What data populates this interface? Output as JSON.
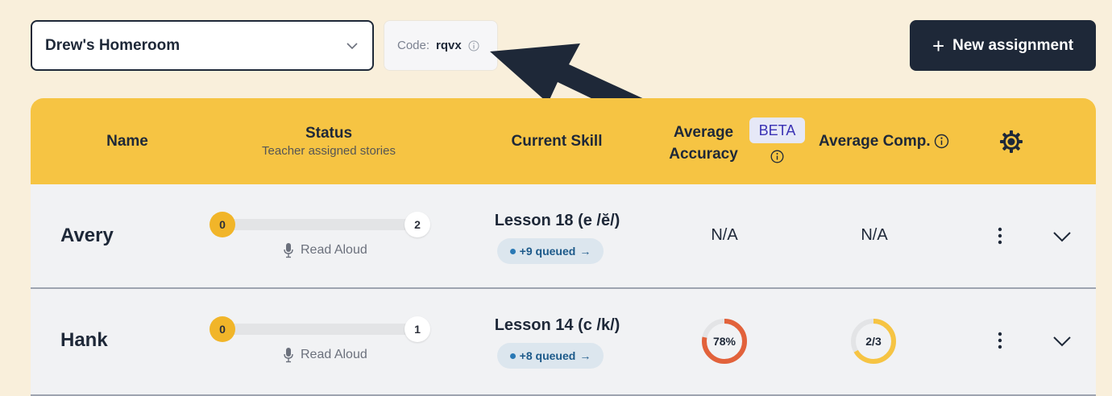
{
  "class_select": {
    "value": "Drew's Homeroom"
  },
  "code": {
    "label": "Code:",
    "value": "rqvx"
  },
  "new_assignment": {
    "label": "New assignment"
  },
  "table": {
    "headers": {
      "name": "Name",
      "status": "Status",
      "status_sub": "Teacher assigned stories",
      "current_skill": "Current Skill",
      "accuracy_line1": "Average",
      "accuracy_line2": "Accuracy",
      "beta": "BETA",
      "comp": "Average Comp."
    },
    "rows": [
      {
        "name": "Avery",
        "progress_start": "0",
        "progress_end": "2",
        "mode": "Read Aloud",
        "skill": "Lesson 18 (e /ĕ/)",
        "queued": "+9 queued",
        "accuracy": "N/A",
        "comp": "N/A"
      },
      {
        "name": "Hank",
        "progress_start": "0",
        "progress_end": "1",
        "mode": "Read Aloud",
        "skill": "Lesson 14 (c /k/)",
        "queued": "+8 queued",
        "accuracy": "78%",
        "accuracy_fraction": 0.78,
        "comp": "2/3",
        "comp_fraction": 0.667
      }
    ]
  },
  "colors": {
    "background": "#f9efdb",
    "header_yellow": "#f6c443",
    "dark_navy": "#1e2838",
    "accuracy_ring": "#e2623b",
    "comp_ring": "#f6c443",
    "beta_bg": "#e6e8f7",
    "beta_text": "#3a31b4"
  }
}
